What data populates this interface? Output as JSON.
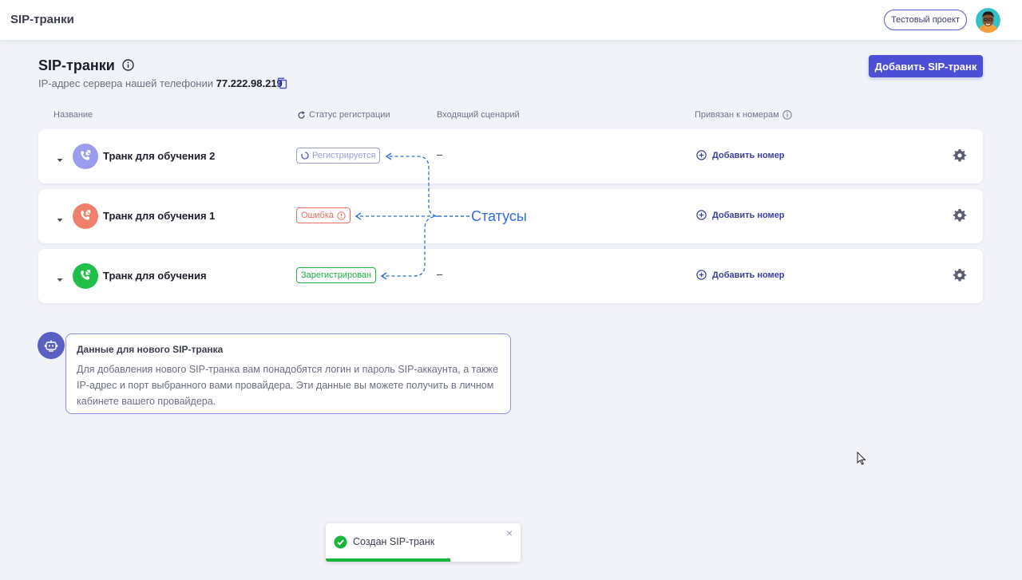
{
  "header": {
    "app_title": "SIP-транки",
    "project_button": "Тестовый проект"
  },
  "page": {
    "title": "SIP-транки",
    "ip_label": "IP-адрес сервера нашей телефонии",
    "ip_value": "77.222.98.219",
    "add_button": "Добавить SIP-транк"
  },
  "table": {
    "headers": {
      "name": "Название",
      "status": "Статус регистрации",
      "scenario": "Входящий сценарий",
      "numbers": "Привязан к номерам"
    },
    "rows": [
      {
        "name": "Транк для обучения 2",
        "status": "Регистрируется",
        "status_kind": "registering",
        "icon_color": "#9a9cef",
        "scenario": "–",
        "add_number": "Добавить номер"
      },
      {
        "name": "Транк для обучения 1",
        "status": "Ошибка",
        "status_kind": "error",
        "icon_color": "#f0806b",
        "scenario": "",
        "add_number": "Добавить номер"
      },
      {
        "name": "Транк для обучения",
        "status": "Зарегистрирован",
        "status_kind": "registered",
        "icon_color": "#1fbf4a",
        "scenario": "–",
        "add_number": "Добавить номер"
      }
    ]
  },
  "annotation": {
    "label": "Статусы",
    "color": "#2f6fd6"
  },
  "hint": {
    "title": "Данные для нового SIP-транка",
    "text": "Для добавления нового SIP-транка вам понадобятся логин и пароль SIP-аккаунта, а также IP-адрес и порт выбранного вами провайдера. Эти данные вы можете получить в личном кабинете вашего провайдера."
  },
  "toast": {
    "message": "Создан SIP-транк",
    "close": "×",
    "progress_percent": 64
  },
  "colors": {
    "accent": "#4a4fd6",
    "success": "#18b53a",
    "error": "#e86d5a"
  }
}
